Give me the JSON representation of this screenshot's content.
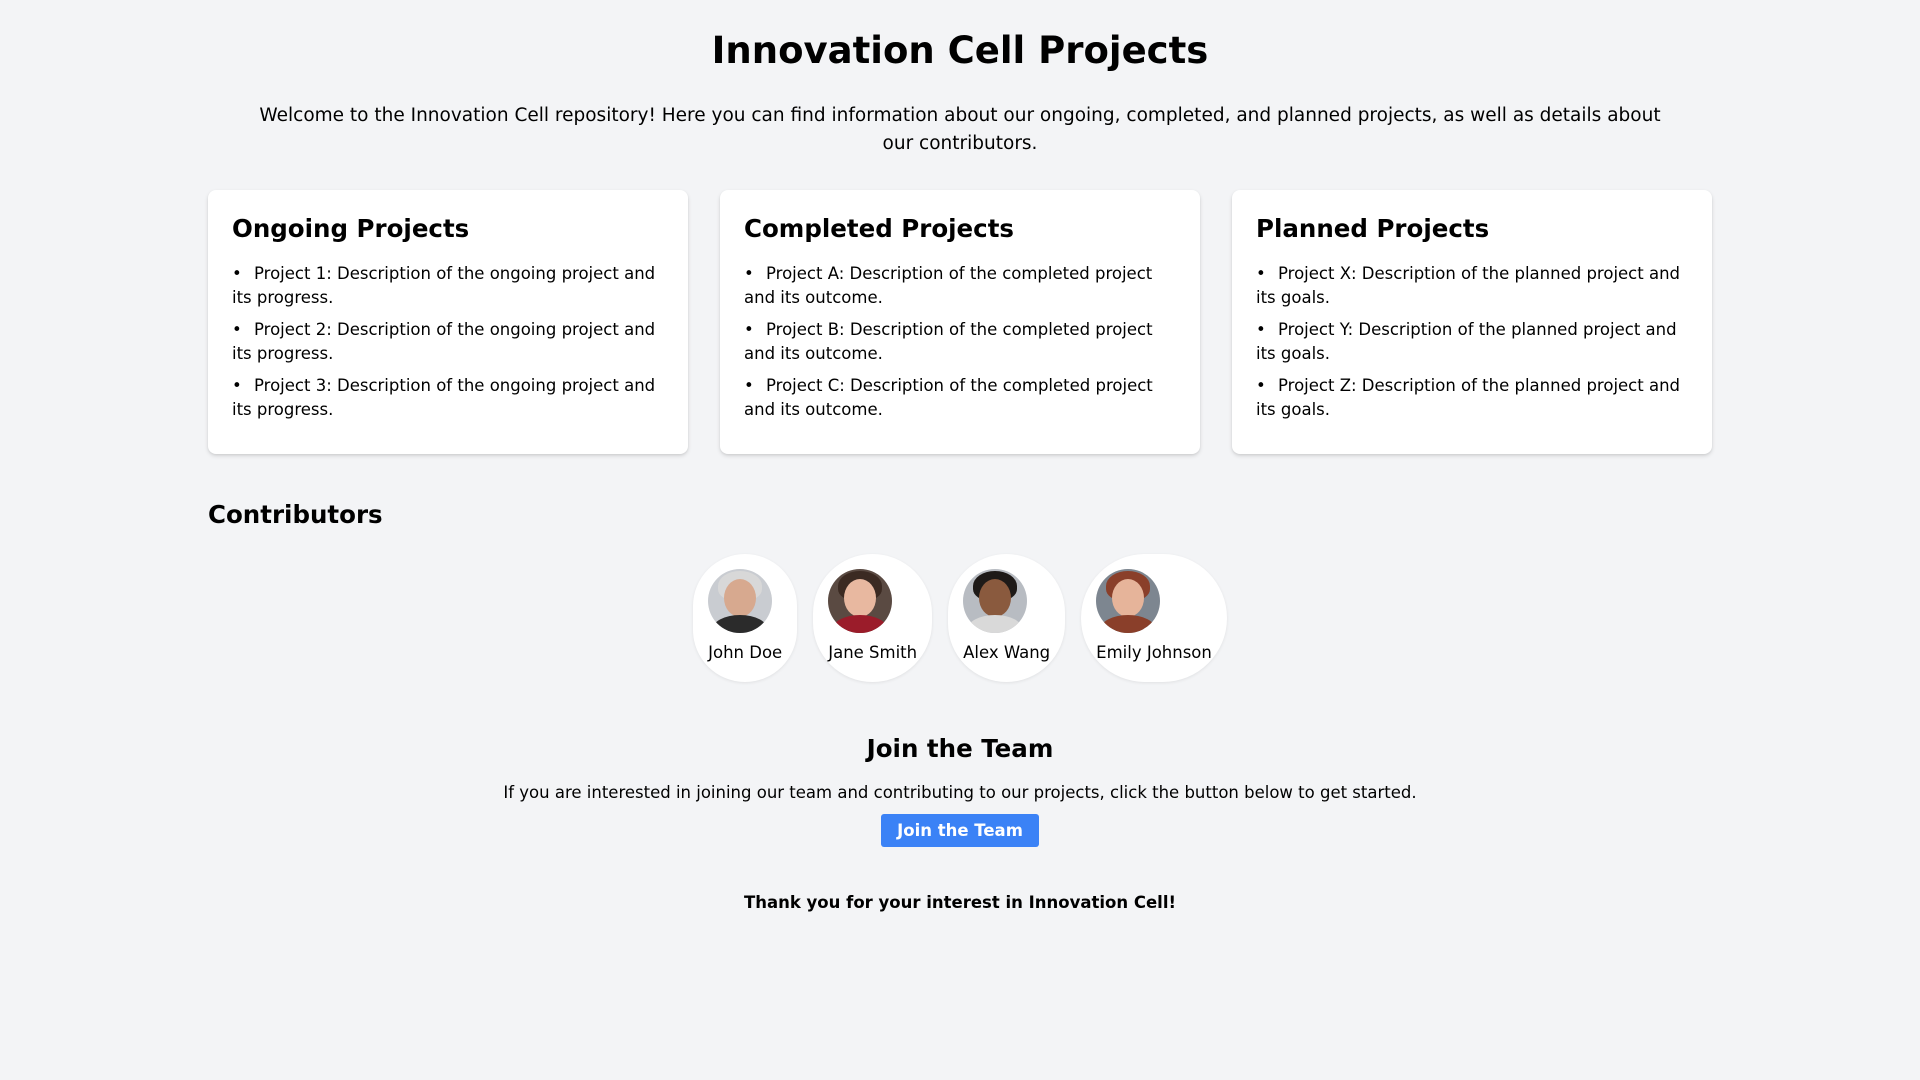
{
  "header": {
    "title": "Innovation Cell Projects",
    "intro": "Welcome to the Innovation Cell repository! Here you can find information about our ongoing, completed, and planned projects, as well as details about our contributors."
  },
  "cards": [
    {
      "title": "Ongoing Projects",
      "items": [
        "Project 1: Description of the ongoing project and its progress.",
        "Project 2: Description of the ongoing project and its progress.",
        "Project 3: Description of the ongoing project and its progress."
      ]
    },
    {
      "title": "Completed Projects",
      "items": [
        "Project A: Description of the completed project and its outcome.",
        "Project B: Description of the completed project and its outcome.",
        "Project C: Description of the completed project and its outcome."
      ]
    },
    {
      "title": "Planned Projects",
      "items": [
        "Project X: Description of the planned project and its goals.",
        "Project Y: Description of the planned project and its goals.",
        "Project Z: Description of the planned project and its goals."
      ]
    }
  ],
  "contributors": {
    "heading": "Contributors",
    "people": [
      {
        "name": "John Doe"
      },
      {
        "name": "Jane Smith"
      },
      {
        "name": "Alex Wang"
      },
      {
        "name": "Emily Johnson"
      }
    ]
  },
  "join": {
    "heading": "Join the Team",
    "text": "If you are interested in joining our team and contributing to our projects, click the button below to get started.",
    "button_label": "Join the Team"
  },
  "footer": {
    "text": "Thank you for your interest in Innovation Cell!"
  },
  "colors": {
    "background": "#f3f4f6",
    "card": "#ffffff",
    "accent": "#3b82f6"
  }
}
